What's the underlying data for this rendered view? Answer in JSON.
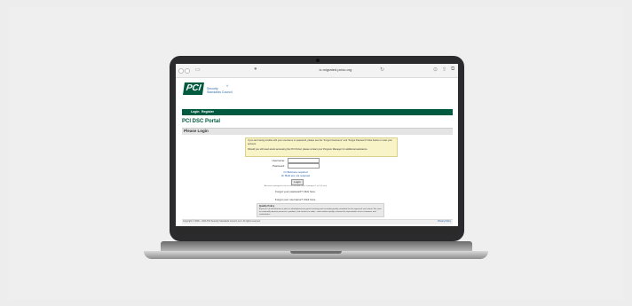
{
  "browser": {
    "url": "ic.migrated.pcisc.org"
  },
  "header": {
    "logo_mark": "PCI",
    "logo_line1": "Security",
    "logo_line2": "Standards Council",
    "nav": [
      "Login",
      "Register"
    ]
  },
  "page": {
    "title": "PCI DSC Portal",
    "section": "Please Login",
    "notice_p1": "If you are having trouble with your username or password, please see the \"Forgot Username\" and \"Forgot Password\" links below or reset your account.",
    "notice_p2": "Should you still need assist accessing the PCI Portal, please contact your Program Manager for additional assistance.",
    "username_label": "Username:",
    "password_label": "Password:",
    "link1": "Or Bold are required",
    "link2": "Or Bold are not required",
    "login_button": "Login",
    "fine_print": "Accounts managed in the last 60 seconds. Max 3 attempts 1 of 3 (3 min)",
    "forgot_password": "Forgot your password? Click here.",
    "forgot_username": "Forgot your username? Click here.",
    "policy_title": "Quality Policy",
    "policy_text": "A process of identification in place to identify/measure goal of meeting and exceeding quality standards for the approach and criteria. We strive to continually improve processes, products, and services in order... and contains quality, continue the expectations of our customers and stakeholders.",
    "footer_left": "Copyright © 2006 – 2021 PCI Security Standards Council, LLC. All rights reserved.",
    "footer_right": "Privacy Policy"
  }
}
